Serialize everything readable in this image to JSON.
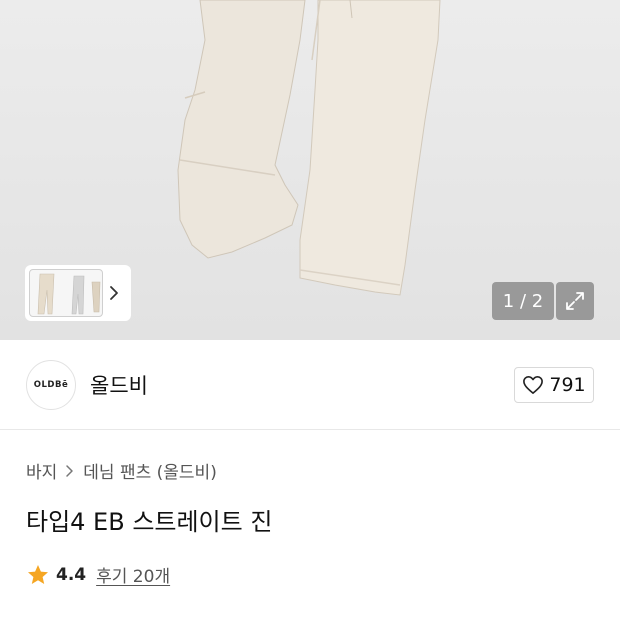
{
  "gallery": {
    "counter": "1 / 2",
    "icons": {
      "thumb_next": "chevron-right-icon",
      "expand": "expand-icon"
    }
  },
  "brand": {
    "logo_text": "OLDBē",
    "name": "올드비",
    "like_count": "791",
    "like_icon": "heart-icon"
  },
  "breadcrumb": {
    "level1": "바지",
    "level2": "데님 팬츠 (올드비)"
  },
  "product": {
    "title": "타입4 EB 스트레이트 진"
  },
  "rating": {
    "score": "4.4",
    "reviews": "후기 20개",
    "star_color": "#f5a623"
  }
}
